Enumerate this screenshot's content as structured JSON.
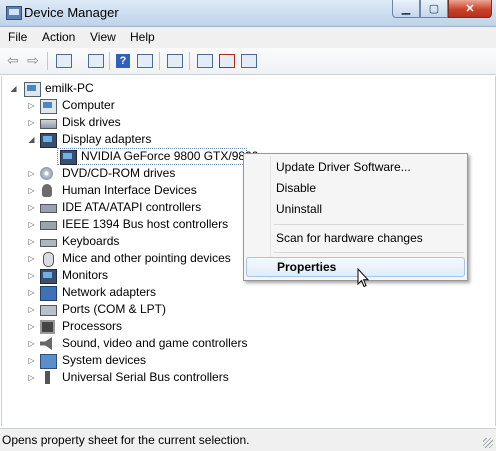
{
  "window": {
    "title": "Device Manager"
  },
  "menubar": [
    "File",
    "Action",
    "View",
    "Help"
  ],
  "toolbar": [
    "back-icon",
    "forward-icon",
    "show-hide-console-tree-icon",
    "properties-icon",
    "help-icon",
    "view-icon",
    "scan-hardware-icon",
    "update-driver-icon",
    "uninstall-icon",
    "disable-icon"
  ],
  "tree": {
    "root": "emilk-PC",
    "categories": [
      "Computer",
      "Disk drives",
      "Display adapters",
      "NVIDIA GeForce 9800 GTX/9800",
      "DVD/CD-ROM drives",
      "Human Interface Devices",
      "IDE ATA/ATAPI controllers",
      "IEEE 1394 Bus host controllers",
      "Keyboards",
      "Mice and other pointing devices",
      "Monitors",
      "Network adapters",
      "Ports (COM & LPT)",
      "Processors",
      "Sound, video and game controllers",
      "System devices",
      "Universal Serial Bus controllers"
    ]
  },
  "context_menu": {
    "items": [
      "Update Driver Software...",
      "Disable",
      "Uninstall",
      "Scan for hardware changes",
      "Properties"
    ]
  },
  "status": {
    "text": "Opens property sheet for the current selection."
  }
}
